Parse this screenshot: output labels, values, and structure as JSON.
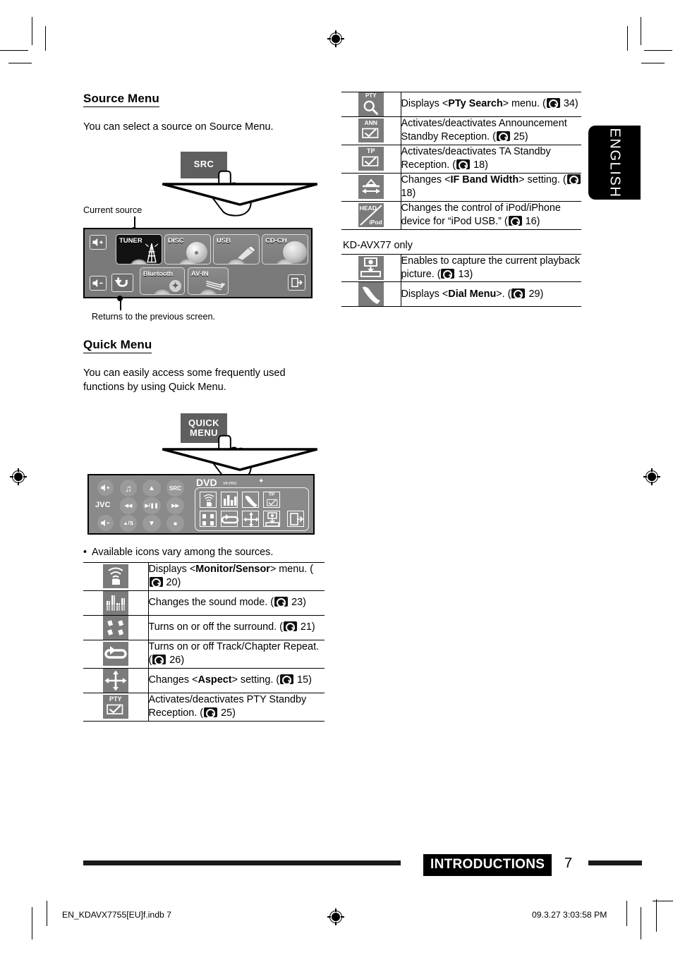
{
  "page": {
    "language_tab": "ENGLISH",
    "footer_section": "INTRODUCTIONS",
    "footer_page_number": "7",
    "imprint_left": "EN_KDAVX7755[EU]f.indb   7",
    "imprint_right": "09.3.27   3:03:58 PM"
  },
  "source_menu": {
    "heading": "Source Menu",
    "intro": "You can select a source on Source Menu.",
    "hw_button_label": "SRC",
    "callout_current_source": "Current source",
    "callout_return": "Returns to the previous screen.",
    "tiles": [
      {
        "label": "TUNER",
        "selected": true
      },
      {
        "label": "DISC",
        "selected": false
      },
      {
        "label": "USB",
        "selected": false
      },
      {
        "label": "CD-CH",
        "selected": false
      },
      {
        "label": "Bluetooth",
        "selected": false
      },
      {
        "label": "AV-IN",
        "selected": false
      }
    ]
  },
  "quick_menu": {
    "heading": "Quick Menu",
    "intro": "You can easily access some frequently used functions by using Quick Menu.",
    "hw_button_line1": "QUICK",
    "hw_button_line2": "MENU",
    "panel": {
      "brand": "JVC",
      "src_label": "SRC",
      "disc_label": "DVD",
      "disc_sub": "VR-PRO",
      "transport": [
        "◀◀",
        "▶/❚❚",
        "▶▶",
        "■"
      ],
      "eject_label": "▲/⇅"
    },
    "note": "Available icons vary among the sources."
  },
  "icon_table_left": {
    "rows": [
      {
        "icon": "monitor-sensor-icon",
        "text_before": "Displays <",
        "bold": "Monitor/Sensor",
        "text_after": "> menu. (",
        "page": "20",
        "text_end": ")"
      },
      {
        "icon": "sound-mode-icon",
        "text_before": "Changes the sound mode. (",
        "bold": "",
        "text_after": "",
        "page": "23",
        "text_end": ")"
      },
      {
        "icon": "surround-icon",
        "text_before": "Turns on or off the surround. (",
        "bold": "",
        "text_after": "",
        "page": "21",
        "text_end": ")"
      },
      {
        "icon": "repeat-icon",
        "text_before": "Turns on or off Track/Chapter Repeat. (",
        "bold": "",
        "text_after": "",
        "page": "26",
        "text_end": ")"
      },
      {
        "icon": "aspect-icon",
        "text_before": "Changes <",
        "bold": "Aspect",
        "text_after": "> setting. (",
        "page": "15",
        "text_end": ")"
      },
      {
        "icon": "pty-standby-icon",
        "text_before": "Activates/deactivates PTY Standby Reception. (",
        "bold": "",
        "text_after": "",
        "page": "25",
        "text_end": ")"
      }
    ]
  },
  "icon_table_right": {
    "rows": [
      {
        "icon": "pty-search-icon",
        "text_before": "Displays <",
        "bold": "PTy Search",
        "text_after": "> menu. (",
        "page": "34",
        "text_end": ")"
      },
      {
        "icon": "announcement-standby-icon",
        "text_before": "Activates/deactivates Announcement Standby Reception. (",
        "bold": "",
        "text_after": "",
        "page": "25",
        "text_end": ")"
      },
      {
        "icon": "ta-standby-icon",
        "text_before": "Activates/deactivates TA Standby Reception. (",
        "bold": "",
        "text_after": "",
        "page": "18",
        "text_end": ")"
      },
      {
        "icon": "if-band-width-icon",
        "text_before": "Changes <",
        "bold": "IF Band Width",
        "text_after": "> setting. (",
        "page": "18",
        "text_end": ")"
      },
      {
        "icon": "head-ipod-icon",
        "text_before": "Changes the control of iPod/iPhone device for “iPod USB.” (",
        "bold": "",
        "text_after": "",
        "page": "16",
        "text_end": ")"
      }
    ]
  },
  "kd_avx77_section": {
    "label": "KD-AVX77 only",
    "rows": [
      {
        "icon": "capture-icon",
        "text_before": "Enables to capture the current playback picture. (",
        "bold": "",
        "text_after": "",
        "page": "13",
        "text_end": ")"
      },
      {
        "icon": "dial-menu-icon",
        "text_before": "Displays <",
        "bold": "Dial Menu",
        "text_after": ">. (",
        "page": "29",
        "text_end": ")"
      }
    ]
  },
  "icon_glyphs": {
    "pty_label": "PTY",
    "ann_label": "ANN",
    "tp_label": "TP",
    "head_label": "HEAD",
    "ipod_label": "iPod"
  }
}
